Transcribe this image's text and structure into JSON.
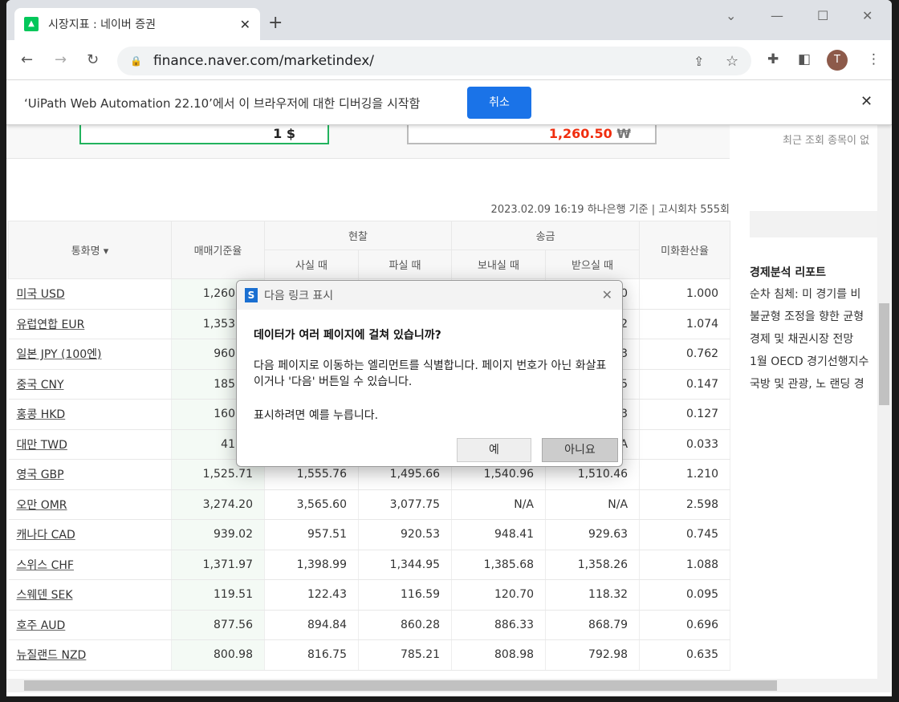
{
  "browser": {
    "tab_title": "시장지표 : 네이버 증권",
    "url": "finance.naver.com/marketindex/",
    "avatar_letter": "T"
  },
  "infobar": {
    "message": "‘UiPath Web Automation 22.10’에서 이 브라우저에 대한 디버깅을 시작함",
    "cancel_label": "취소"
  },
  "converter": {
    "from_value": "1 $",
    "to_value": "1,260.50",
    "to_unit": "₩"
  },
  "sidebar": {
    "recent": "최근 조회 종목이 없",
    "report_title": "경제분석 리포트",
    "reports": [
      "순차 침체: 미 경기를 비",
      "불균형 조정을 향한 균형",
      "경제 및 채권시장 전망",
      "1월 OECD 경기선행지수",
      "국방 및 관광, 노 랜딩 경"
    ]
  },
  "table": {
    "stamp": "2023.02.09 16:19  하나은행 기준 | 고시회차 555회",
    "headers": {
      "name": "통화명 ▾",
      "base": "매매기준율",
      "cash": "현찰",
      "remit": "송금",
      "buy": "사실 때",
      "sell": "파실 때",
      "send": "보내실 때",
      "receive": "받으실 때",
      "usd_rate": "미화환산율"
    },
    "rows": [
      [
        "미국 USD",
        "1,260",
        "",
        "",
        "",
        "0",
        "1.000"
      ],
      [
        "유럽연합 EUR",
        "1,353",
        "",
        "",
        "",
        "2",
        "1.074"
      ],
      [
        "일본 JPY (100엔)",
        "960",
        "",
        "",
        "",
        "3",
        "0.762"
      ],
      [
        "중국 CNY",
        "185",
        "",
        "",
        "",
        "5",
        "0.147"
      ],
      [
        "홍콩 HKD",
        "160",
        "",
        "",
        "",
        "3",
        "0.127"
      ],
      [
        "대만 TWD",
        "41",
        "",
        "",
        "",
        "A",
        "0.033"
      ],
      [
        "영국 GBP",
        "1,525.71",
        "1,555.76",
        "1,495.66",
        "1,540.96",
        "1,510.46",
        "1.210"
      ],
      [
        "오만 OMR",
        "3,274.20",
        "3,565.60",
        "3,077.75",
        "N/A",
        "N/A",
        "2.598"
      ],
      [
        "캐나다 CAD",
        "939.02",
        "957.51",
        "920.53",
        "948.41",
        "929.63",
        "0.745"
      ],
      [
        "스위스 CHF",
        "1,371.97",
        "1,398.99",
        "1,344.95",
        "1,385.68",
        "1,358.26",
        "1.088"
      ],
      [
        "스웨덴 SEK",
        "119.51",
        "122.43",
        "116.59",
        "120.70",
        "118.32",
        "0.095"
      ],
      [
        "호주 AUD",
        "877.56",
        "894.84",
        "860.28",
        "886.33",
        "868.79",
        "0.696"
      ],
      [
        "뉴질랜드 NZD",
        "800.98",
        "816.75",
        "785.21",
        "808.98",
        "792.98",
        "0.635"
      ]
    ]
  },
  "dialog": {
    "title": "다음 링크 표시",
    "question": "데이터가 여러 페이지에 걸쳐 있습니까?",
    "description": "다음 페이지로 이동하는 엘리먼트를 식별합니다. 페이지 번호가 아닌 화살표이거나 '다음' 버튼일 수 있습니다.",
    "prompt": "표시하려면 예를 누릅니다.",
    "yes": "예",
    "no": "아니요"
  }
}
